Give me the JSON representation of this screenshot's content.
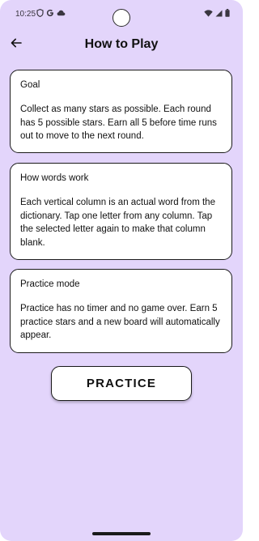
{
  "status_bar": {
    "time": "10:25",
    "left_icons": [
      "shield-icon",
      "google-g-icon",
      "cloud-icon"
    ],
    "right_icons": [
      "wifi-icon",
      "signal-icon",
      "battery-icon"
    ]
  },
  "header": {
    "title": "How to Play",
    "back_icon": "arrow-left-icon"
  },
  "cards": [
    {
      "title": "Goal",
      "body": "Collect as many stars as possible. Each round has 5 possible stars. Earn all 5 before time runs out to move to the next round."
    },
    {
      "title": "How words work",
      "body": "Each vertical column is an actual word from the dictionary. Tap one letter from any column. Tap the selected letter again to make that column blank."
    },
    {
      "title": "Practice mode",
      "body": "Practice has no timer and no game over. Earn 5 practice stars and a new board will automatically appear."
    }
  ],
  "practice_button": {
    "label": "PRACTICE"
  },
  "colors": {
    "background": "#e3d5fb",
    "card": "#ffffff",
    "border": "#1a1a1a",
    "text": "#111111"
  }
}
